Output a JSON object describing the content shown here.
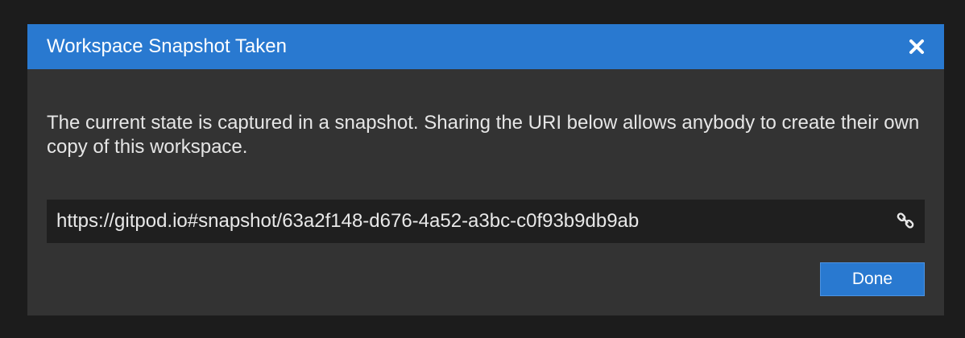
{
  "dialog": {
    "title": "Workspace Snapshot Taken",
    "close_icon": "close-icon",
    "message": "The current state is captured in a snapshot. Sharing the URI below allows anybody to create their own copy of this workspace.",
    "uri_value": "https://gitpod.io#snapshot/63a2f148-d676-4a52-a3bc-c0f93b9db9ab",
    "copy_icon": "link-icon",
    "done_label": "Done"
  },
  "colors": {
    "titlebar": "#2979d0",
    "dialog_background": "#333333",
    "field_background": "#1f1f1f",
    "page_background": "#1c1c1c"
  }
}
